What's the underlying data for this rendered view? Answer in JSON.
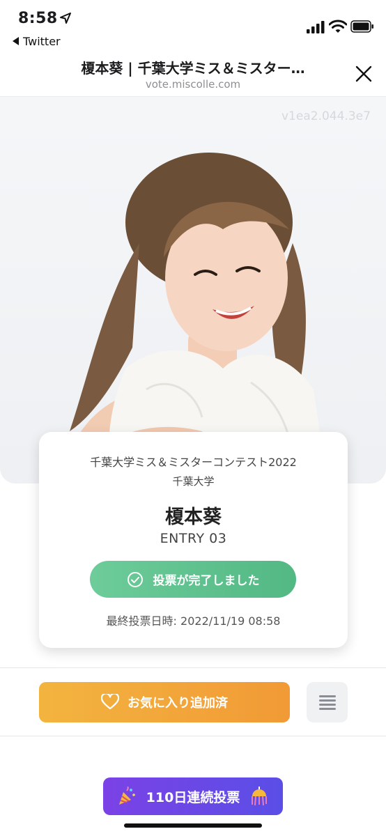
{
  "status_bar": {
    "time": "8:58",
    "back_app": "Twitter",
    "icons": [
      "location-arrow-icon",
      "signal-icon",
      "wifi-icon",
      "battery-icon"
    ]
  },
  "header": {
    "title": "榎本葵 | 千葉大学ミス＆ミスター…",
    "url": "vote.miscolle.com",
    "close_icon": "close-icon"
  },
  "hero": {
    "watermark": "v1ea2.044.3e7"
  },
  "card": {
    "contest": "千葉大学ミス＆ミスターコンテスト2022",
    "university": "千葉大学",
    "name": "榎本葵",
    "entry": "ENTRY 03",
    "vote_button": "投票が完了しました",
    "last_vote": "最終投票日時: 2022/11/19 08:58"
  },
  "actions": {
    "favorite_button": "お気に入り追加済",
    "menu_icon": "menu-icon"
  },
  "streak": {
    "label": "110日連続投票"
  },
  "colors": {
    "vote_green": "#5fc18f",
    "favorite_orange": "#f2a63a",
    "streak_purple": "#6a48e6"
  }
}
